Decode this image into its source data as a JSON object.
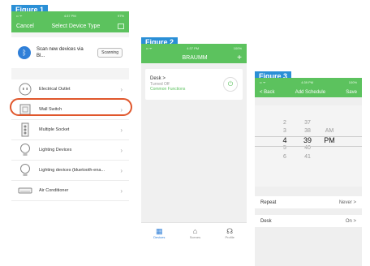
{
  "figures": [
    "Figure 1",
    "Figure 2",
    "Figure 3"
  ],
  "colors": {
    "accent_green": "#5cc25e",
    "figure_label": "#2a8fd6",
    "highlight": "#e0572c",
    "bluetooth": "#2f7fd8"
  },
  "phone1": {
    "status": {
      "signal": "•• ᯤ",
      "time": "4:37 PM",
      "battery": "97%"
    },
    "nav": {
      "cancel": "Cancel",
      "title": "Select Device Type",
      "scan_icon": "frame-icon"
    },
    "scan": {
      "text": "Scan new devices via Bl...",
      "button": "Scanning",
      "icon": "bluetooth-icon"
    },
    "devices": [
      {
        "label": "Electrical Outlet",
        "icon": "outlet-icon"
      },
      {
        "label": "Wall Switch",
        "icon": "wall-switch-icon"
      },
      {
        "label": "Multiple Socket",
        "icon": "power-strip-icon"
      },
      {
        "label": "Lighting Devices",
        "icon": "bulb-icon"
      },
      {
        "label": "Lighting devices (bluetooth-ena...",
        "icon": "bulb-icon"
      },
      {
        "label": "Air Conditioner",
        "icon": "ac-icon"
      }
    ]
  },
  "phone2": {
    "status": {
      "signal": "•• ᯤ",
      "time": "4:37 PM",
      "battery": "100%"
    },
    "nav": {
      "title": "BRAUMM",
      "add": "+"
    },
    "device": {
      "name": "Desk >",
      "status": "Turned Off",
      "link": "Common Functions"
    },
    "tabs": [
      {
        "label": "Devices",
        "icon": "grid-icon"
      },
      {
        "label": "Scenes",
        "icon": "home-icon"
      },
      {
        "label": "Profile",
        "icon": "headset-icon"
      }
    ]
  },
  "phone3": {
    "status": {
      "signal": "•• ᯤ",
      "time": "4:39 PM",
      "battery": "100%"
    },
    "nav": {
      "back": "< Back",
      "title": "Add Schedule",
      "save": "Save"
    },
    "picker": {
      "hours": [
        "",
        "2",
        "3",
        "4",
        "5",
        "6",
        ""
      ],
      "minutes": [
        "",
        "37",
        "38",
        "39",
        "40",
        "41",
        ""
      ],
      "ampm": [
        "AM",
        "PM"
      ]
    },
    "repeat": {
      "label": "Repeat",
      "value": "Never >"
    },
    "desk": {
      "label": "Desk",
      "value": "On >"
    }
  }
}
